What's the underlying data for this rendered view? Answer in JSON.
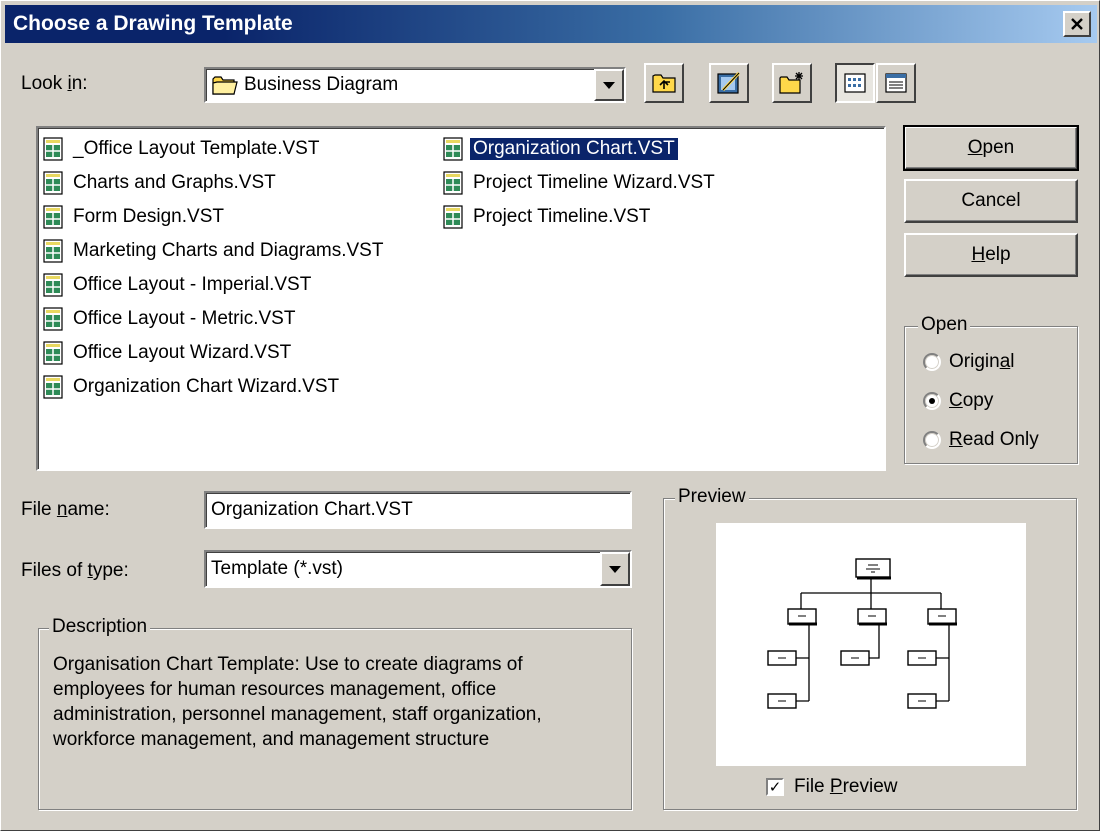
{
  "window": {
    "title": "Choose a Drawing Template",
    "close_icon": "close-icon"
  },
  "look_in": {
    "label_pre": "Look ",
    "label_accel": "i",
    "label_post": "n:",
    "value": "Business Diagram",
    "icon": "folder-icon"
  },
  "toolbar": {
    "buttons": [
      "up-one-level-icon",
      "web-search-icon",
      "create-new-folder-icon",
      "list-view-icon",
      "details-view-icon"
    ],
    "active": "list-view-icon"
  },
  "files": {
    "column1": [
      "_Office Layout Template.VST",
      "Charts and Graphs.VST",
      "Form Design.VST",
      "Marketing Charts and Diagrams.VST",
      "Office Layout - Imperial.VST",
      "Office Layout - Metric.VST",
      "Office Layout Wizard.VST",
      "Organization Chart Wizard.VST"
    ],
    "column2": [
      "Organization Chart.VST",
      "Project Timeline Wizard.VST",
      "Project Timeline.VST"
    ],
    "selected": "Organization Chart.VST",
    "icon": "template-file-icon"
  },
  "buttons": {
    "open": {
      "accel": "O",
      "rest": "pen"
    },
    "cancel": "Cancel",
    "help": {
      "accel": "H",
      "rest": "elp"
    }
  },
  "open_mode": {
    "title": "Open",
    "options": [
      {
        "pre": "Origin",
        "accel": "a",
        "post": "l",
        "checked": false
      },
      {
        "pre": "",
        "accel": "C",
        "post": "opy",
        "checked": true
      },
      {
        "pre": "",
        "accel": "R",
        "post": "ead Only",
        "checked": false
      }
    ]
  },
  "file_name": {
    "label_pre": "File ",
    "label_accel": "n",
    "label_post": "ame:",
    "value": "Organization Chart.VST"
  },
  "files_of_type": {
    "label_pre": "Files of ",
    "label_accel": "t",
    "label_post": "ype:",
    "value": "Template (*.vst)"
  },
  "description": {
    "title": "Description",
    "text": "Organisation Chart Template:  Use to create diagrams of employees for human resources management, office administration, personnel management, staff organization, workforce management, and management structure"
  },
  "preview": {
    "title": "Preview",
    "checkbox_pre": "File ",
    "checkbox_accel": "P",
    "checkbox_post": "review",
    "checked": true
  }
}
